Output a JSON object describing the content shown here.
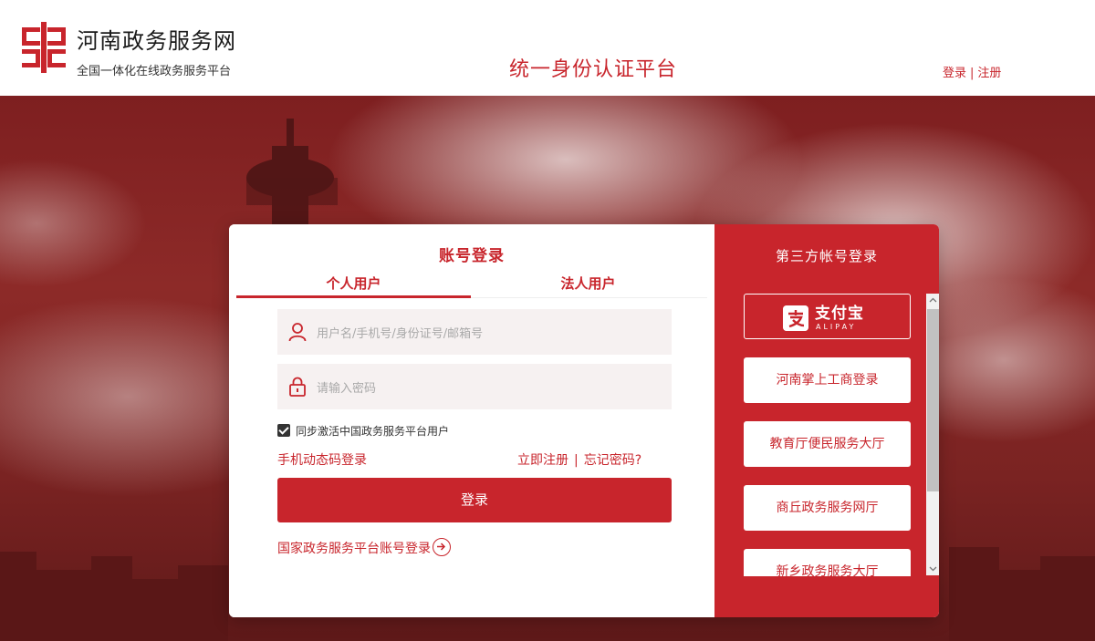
{
  "header": {
    "site_title": "河南政务服务网",
    "site_subtitle": "全国一体化在线政务服务平台",
    "platform_title": "统一身份认证平台",
    "login_link": "登录",
    "register_link": "注册",
    "link_separator": "|"
  },
  "login": {
    "title": "账号登录",
    "tabs": [
      {
        "label": "个人用户",
        "active": true
      },
      {
        "label": "法人用户",
        "active": false
      }
    ],
    "username_placeholder": "用户名/手机号/身份证号/邮箱号",
    "password_placeholder": "请输入密码",
    "sync_label": "同步激活中国政务服务平台用户",
    "sync_checked": true,
    "sms_login": "手机动态码登录",
    "register_now": "立即注册",
    "separator": "|",
    "forgot_password": "忘记密码?",
    "submit": "登录",
    "national_login": "国家政务服务平台账号登录"
  },
  "third_party": {
    "title": "第三方帐号登录",
    "alipay_text": "支付宝",
    "alipay_sub": "ALIPAY",
    "items": [
      "河南掌上工商登录",
      "教育厅便民服务大厅",
      "商丘政务服务网厅",
      "新乡政务服务大厅"
    ]
  },
  "colors": {
    "brand_red": "#c8252c",
    "input_bg": "#f6f1f1"
  },
  "icons": {
    "user": "user-icon",
    "lock": "lock-icon",
    "arrow": "arrow-right-circle-icon",
    "logo": "henan-logo-icon",
    "alipay": "alipay-icon"
  }
}
